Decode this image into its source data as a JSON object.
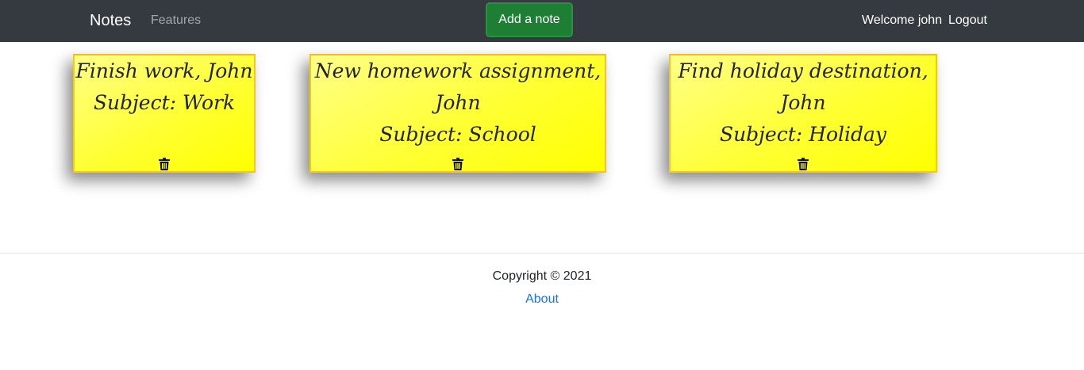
{
  "navbar": {
    "brand": "Notes",
    "features_link": "Features",
    "add_button": "Add a note",
    "welcome": "Welcome john",
    "logout": "Logout",
    "bg_color": "#343a40",
    "button_color": "#1e7e34"
  },
  "notes": [
    {
      "title": "Finish work, John",
      "subject": "Subject: Work",
      "delete_icon": "trash-icon"
    },
    {
      "title": "New homework assignment, John",
      "subject": "Subject: School",
      "delete_icon": "trash-icon"
    },
    {
      "title": "Find holiday destination, John",
      "subject": "Subject: Holiday",
      "delete_icon": "trash-icon"
    }
  ],
  "note_color": "#ffff00",
  "footer": {
    "copyright": "Copyright © 2021",
    "about": "About",
    "link_color": "#1a73e8"
  }
}
